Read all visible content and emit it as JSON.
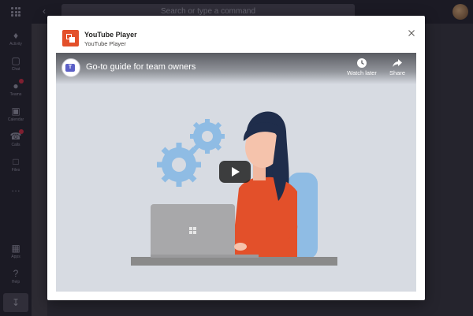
{
  "app": {
    "search_placeholder": "Search or type a command",
    "rail": [
      {
        "label": "Activity",
        "icon": "bell-icon"
      },
      {
        "label": "Chat",
        "icon": "chat-icon"
      },
      {
        "label": "Teams",
        "icon": "teams-icon"
      },
      {
        "label": "Calendar",
        "icon": "calendar-icon"
      },
      {
        "label": "Calls",
        "icon": "phone-icon"
      },
      {
        "label": "Files",
        "icon": "files-icon"
      },
      {
        "label": "Apps",
        "icon": "apps-icon"
      },
      {
        "label": "Help",
        "icon": "help-icon"
      }
    ]
  },
  "modal": {
    "title": "YouTube Player",
    "subtitle": "YouTube Player",
    "accent_color": "#e3502a"
  },
  "player": {
    "video_title": "Go-to guide for team owners",
    "watch_later_label": "Watch later",
    "share_label": "Share"
  }
}
